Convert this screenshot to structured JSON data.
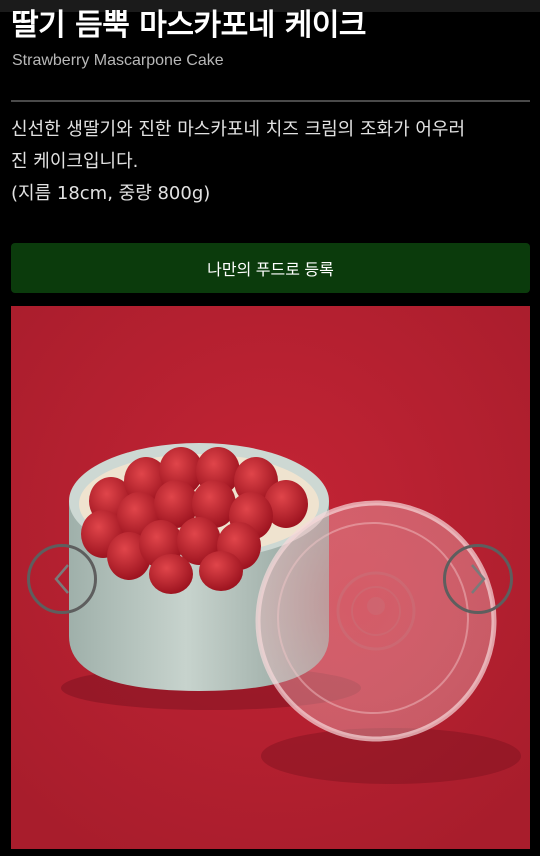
{
  "product": {
    "title": "딸기 듬뿍 마스카포네 케이크",
    "subtitle": "Strawberry Mascarpone Cake",
    "description_line1": "신선한 생딸기와 진한 마스카포네 치즈 크림의 조화가 어우러",
    "description_line2": "진 케이크입니다.",
    "description_line3": "(지름 18cm, 중량 800g)"
  },
  "actions": {
    "register_label": "나만의 푸드로 등록"
  },
  "carousel": {
    "prev_icon": "chevron-left-icon",
    "next_icon": "chevron-right-icon"
  },
  "colors": {
    "background": "#000000",
    "accent_button": "#0b3b0c",
    "photo_background": "#b22130"
  }
}
